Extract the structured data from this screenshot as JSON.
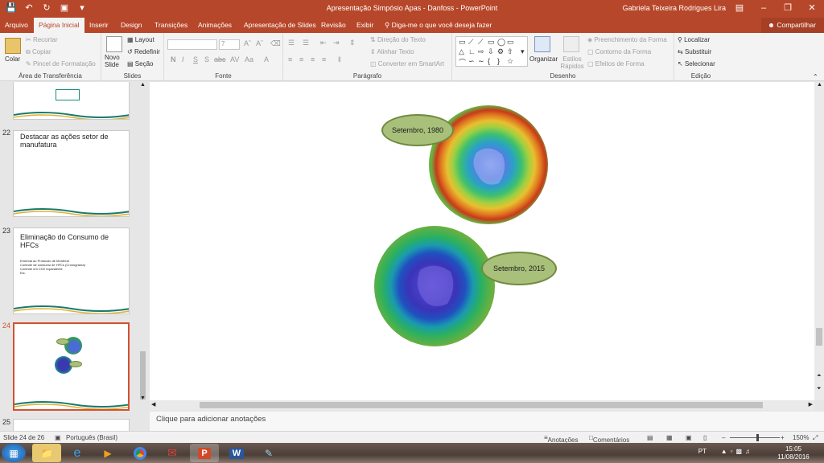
{
  "window": {
    "title": "Apresentação Simpósio Apas - Danfoss - PowerPoint",
    "user": "Gabriela Teixeira Rodrigues Lira"
  },
  "tabs": [
    {
      "label": "Arquivo"
    },
    {
      "label": "Página Inicial"
    },
    {
      "label": "Inserir"
    },
    {
      "label": "Design"
    },
    {
      "label": "Transições"
    },
    {
      "label": "Animações"
    },
    {
      "label": "Apresentação de Slides"
    },
    {
      "label": "Revisão"
    },
    {
      "label": "Exibir"
    }
  ],
  "tell_me": "Diga-me o que você deseja fazer",
  "share": "Compartilhar",
  "ribbon": {
    "clipboard": {
      "paste": "Colar",
      "cut": "Recortar",
      "copy": "Copiar",
      "format_painter": "Pincel de Formatação",
      "label": "Área de Transferência"
    },
    "slides": {
      "new_slide": "Novo Slide",
      "layout": "Layout",
      "reset": "Redefinir",
      "section": "Seção",
      "label": "Slides"
    },
    "font": {
      "size": "7",
      "label": "Fonte"
    },
    "paragraph": {
      "text_direction": "Direção do Texto",
      "align_text": "Alinhar Texto",
      "smartart": "Converter em SmartArt",
      "label": "Parágrafo"
    },
    "drawing": {
      "arrange": "Organizar",
      "quick_styles": "Estilos Rápidos",
      "fill": "Preenchimento da Forma",
      "outline": "Contorno da Forma",
      "effects": "Efeitos de Forma",
      "label": "Desenho"
    },
    "editing": {
      "find": "Localizar",
      "replace": "Substituir",
      "select": "Selecionar",
      "label": "Edição"
    }
  },
  "thumbnails": [
    {
      "num": "22",
      "title": "Destacar as ações setor de manufatura"
    },
    {
      "num": "23",
      "title": "Eliminação do Consumo de HFCs",
      "body": [
        "Emenda ao Protocolo de Montreal",
        "Controle de consumo de HFCs (Cronograma)",
        "Controle em CO2 equivalente",
        "Etc."
      ]
    },
    {
      "num": "24"
    },
    {
      "num": "25"
    }
  ],
  "slide": {
    "callout_1": "Setembro, 1980",
    "callout_2": "Setembro, 2015"
  },
  "notes_placeholder": "Clique para adicionar anotações",
  "status": {
    "slide": "Slide 24 de 26",
    "language": "Português (Brasil)",
    "notes": "Anotações",
    "comments": "Comentários",
    "zoom": "150%"
  },
  "tray": {
    "lang": "PT",
    "time": "15:05",
    "date": "11/08/2016"
  }
}
